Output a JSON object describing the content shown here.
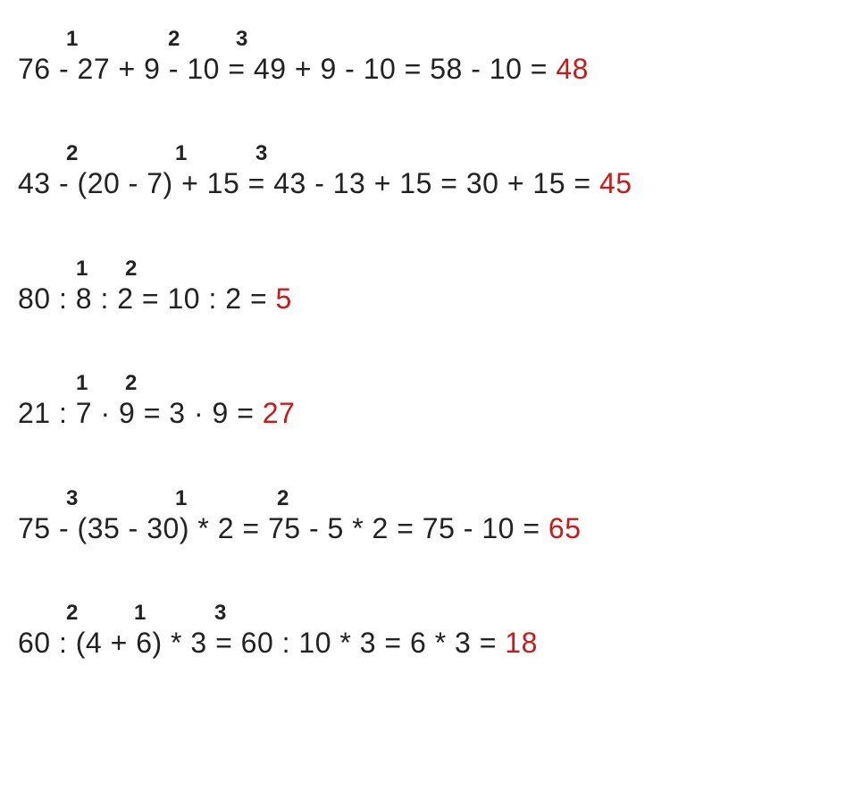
{
  "equations": [
    {
      "steps": [
        "1",
        "2",
        "3"
      ],
      "positions": [
        54,
        168,
        244
      ],
      "expr_pre": "76 - 27 + 9 - 10 = 49 + 9 - 10 = 58 - 10 = ",
      "result": "48"
    },
    {
      "steps": [
        "2",
        "1",
        "3"
      ],
      "positions": [
        54,
        176,
        266
      ],
      "expr_pre": "43 - (20 - 7) + 15 = 43 - 13 + 15 = 30 + 15 = ",
      "result": "45"
    },
    {
      "steps": [
        "1",
        "2"
      ],
      "positions": [
        65,
        120
      ],
      "expr_pre": "80 : 8 : 2 = 10 : 2 = ",
      "result": "5"
    },
    {
      "steps": [
        "1",
        "2"
      ],
      "positions": [
        65,
        120
      ],
      "expr_pre": "21 : 7 · 9 = 3 · 9 = ",
      "result": "27"
    },
    {
      "steps": [
        "3",
        "1",
        "2"
      ],
      "positions": [
        54,
        176,
        290
      ],
      "expr_pre": "75 - (35 - 30) * 2 = 75 - 5 * 2 = 75 - 10 = ",
      "result": "65"
    },
    {
      "steps": [
        "2",
        "1",
        "3"
      ],
      "positions": [
        54,
        130,
        220
      ],
      "expr_pre": "60 : (4 + 6) * 3 = 60 : 10 * 3 = 6 * 3 = ",
      "result": "18"
    }
  ]
}
